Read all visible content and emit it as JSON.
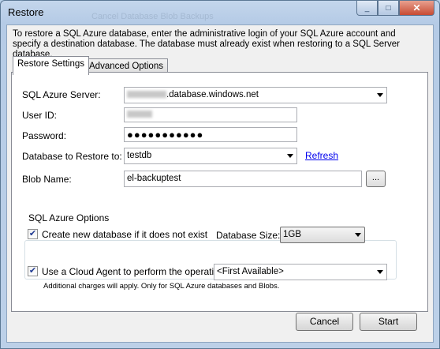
{
  "window": {
    "title": "Restore",
    "ghost_text": "Cancel    Database    Blob Backups",
    "minimize_glyph": "_",
    "maximize_glyph": "□",
    "close_glyph": "✕"
  },
  "intro": "To restore a SQL Azure database, enter the administrative login of your SQL Azure account and specify a destination database. The database must already exist when restoring to a SQL Server database.",
  "tabs": [
    {
      "label": "Restore Settings",
      "active": true
    },
    {
      "label": "Advanced Options",
      "active": false
    }
  ],
  "form": {
    "server_label": "SQL Azure Server:",
    "server_value": ".database.windows.net",
    "userid_label": "User ID:",
    "password_label": "Password:",
    "password_value": "●●●●●●●●●●●",
    "db_label": "Database to Restore to:",
    "db_value": "testdb",
    "refresh_label": "Refresh",
    "blob_label": "Blob Name:",
    "blob_value": "el-backuptest",
    "browse_label": "..."
  },
  "options": {
    "group_title": "SQL Azure Options",
    "create_db_label": "Create new database if it does not exist",
    "create_db_checked": true,
    "db_size_label": "Database Size:",
    "db_size_value": "1GB"
  },
  "agent": {
    "checkbox_label": "Use a Cloud Agent to perform the operation:",
    "checked": true,
    "agent_value": "<First Available>",
    "note": "Additional charges will apply.  Only for SQL Azure databases and Blobs."
  },
  "buttons": {
    "cancel": "Cancel",
    "start": "Start"
  }
}
